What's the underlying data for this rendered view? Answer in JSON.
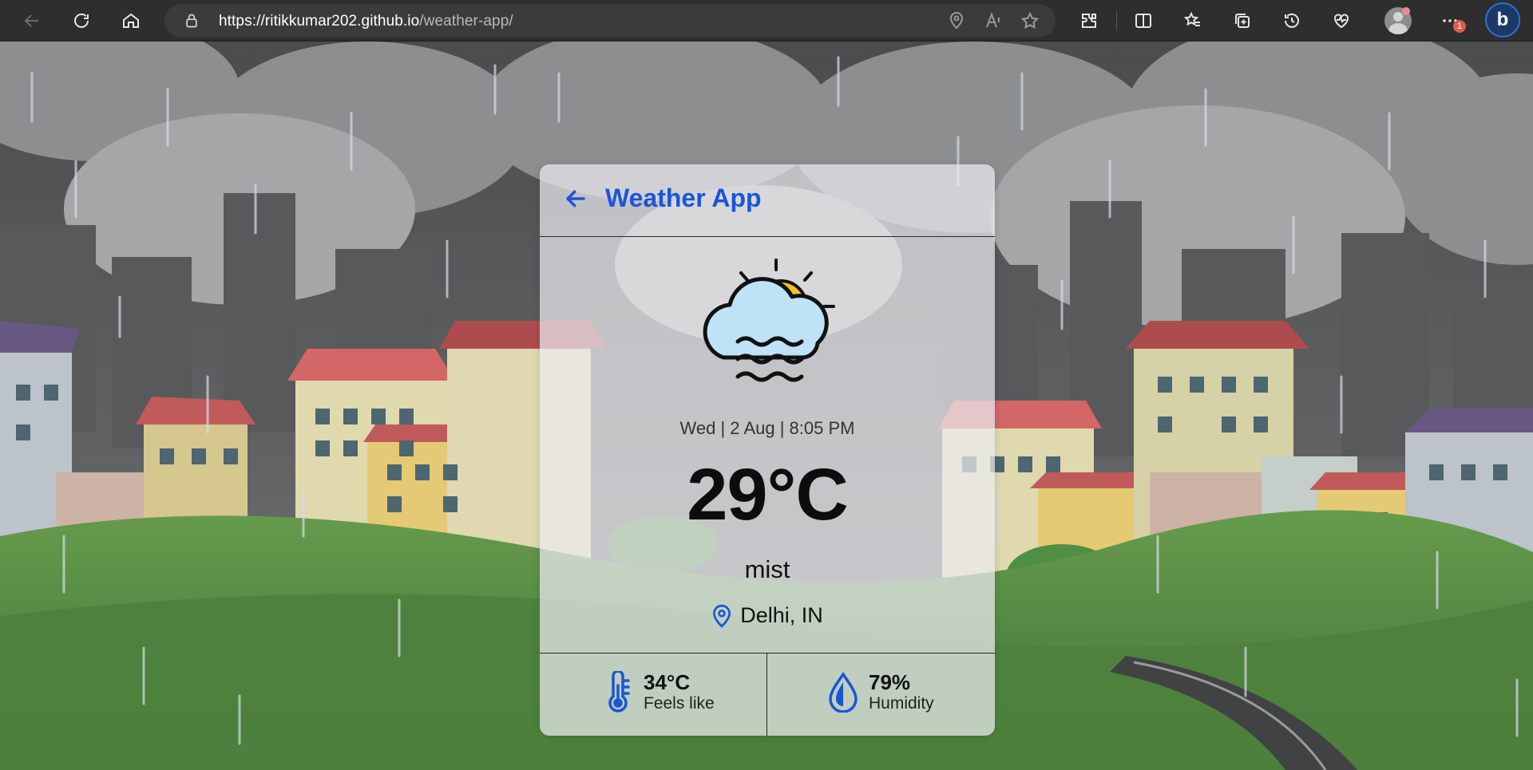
{
  "browser": {
    "url_host": "https://ritikkumar202.github.io",
    "url_path": "/weather-app/",
    "notification_count": "1",
    "colors": {
      "toolbar": "#2e2e2e",
      "address_bar": "#3b3b3b"
    }
  },
  "app": {
    "title": "Weather App",
    "datetime": "Wed | 2 Aug | 8:05 PM",
    "temperature": "29°C",
    "description": "mist",
    "location": "Delhi, IN",
    "feels_like": {
      "value": "34°C",
      "label": "Feels like"
    },
    "humidity": {
      "value": "79%",
      "label": "Humidity"
    },
    "icons": {
      "back": "arrow-left-icon",
      "weather": "cloud-sun-mist-icon",
      "location": "map-pin-icon",
      "feels_like": "thermometer-icon",
      "humidity": "water-drop-icon"
    },
    "colors": {
      "accent": "#1a55d8",
      "card_bg": "rgba(235,235,240,0.72)"
    }
  }
}
